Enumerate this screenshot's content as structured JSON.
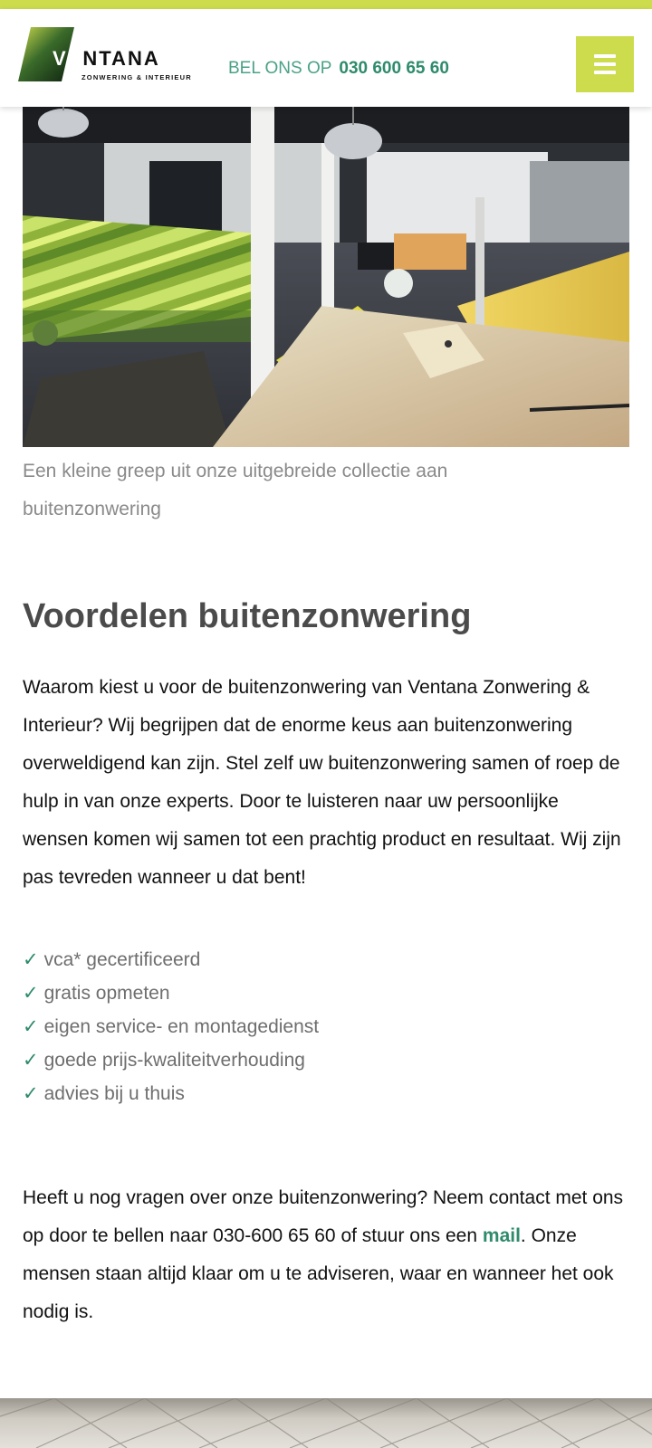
{
  "header": {
    "logo_text": "VENTANA",
    "logo_tagline": "ZONWERING & INTERIEUR",
    "call_label": "BEL ONS OP",
    "call_number": "030 600 65 60",
    "menu_icon": "hamburger-icon"
  },
  "hero": {
    "caption": "Een kleine greep uit onze uitgebreide collectie aan buitenzonwering"
  },
  "section": {
    "title": "Voordelen buitenzonwering",
    "intro": "Waarom kiest u voor de buitenzonwering van Ventana Zonwering & Interieur? Wij begrijpen dat de enorme keus aan buitenzonwering overweldigend kan zijn. Stel zelf uw buitenzonwering samen of roep de hulp in van onze experts.  Door te luisteren naar uw persoonlijke wensen komen wij samen tot een prachtig product en resultaat. Wij zijn pas tevreden wanneer u dat bent!",
    "checks": [
      "vca* gecertificeerd",
      "gratis opmeten",
      "eigen service- en montagedienst",
      "goede prijs-kwaliteitverhouding",
      "advies bij u thuis"
    ],
    "check_symbol": "✓",
    "contact_before": "Heeft u nog vragen over onze buitenzonwering? Neem contact met ons op door te bellen naar 030-600 65 60 of stuur ons een ",
    "contact_link": "mail",
    "contact_after": ". Onze mensen staan altijd klaar om u te adviseren, waar en wanneer het ook nodig is."
  },
  "colors": {
    "brand_lime": "#cddc4d",
    "brand_green": "#2e8b6b",
    "heading": "#4b4b4b",
    "muted": "#8a8a8a"
  }
}
